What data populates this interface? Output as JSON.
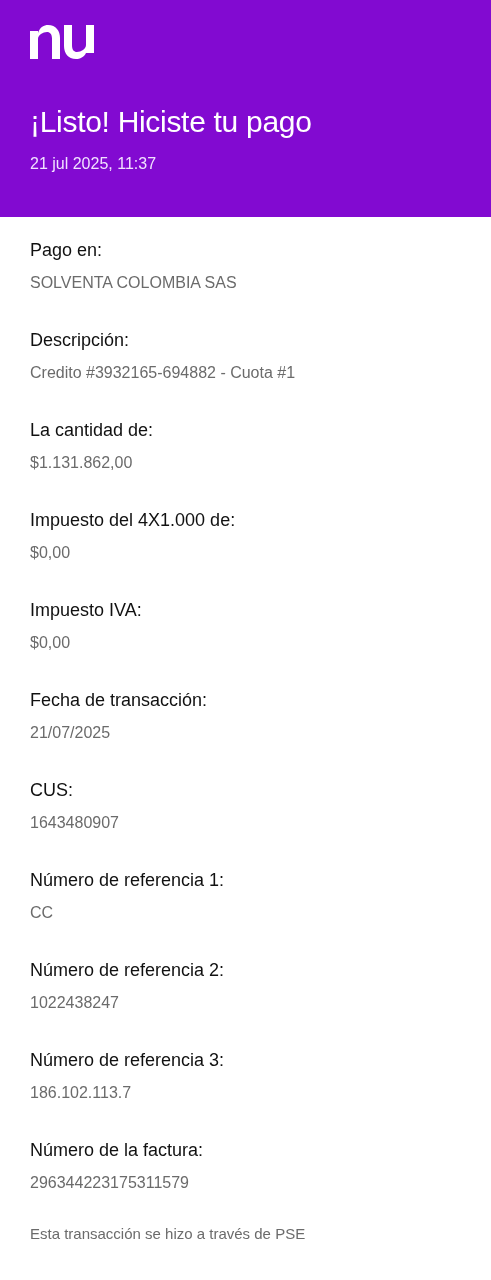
{
  "header": {
    "title": "¡Listo! Hiciste tu pago",
    "datetime": "21 jul 2025, 11:37"
  },
  "details": [
    {
      "label": "Pago en:",
      "value": "SOLVENTA COLOMBIA SAS"
    },
    {
      "label": "Descripción:",
      "value": "Credito #3932165-694882 - Cuota #1"
    },
    {
      "label": "La cantidad de:",
      "value": "$1.131.862,00"
    },
    {
      "label": "Impuesto del 4X1.000 de:",
      "value": "$0,00"
    },
    {
      "label": "Impuesto IVA:",
      "value": "$0,00"
    },
    {
      "label": "Fecha de transacción:",
      "value": "21/07/2025"
    },
    {
      "label": "CUS:",
      "value": "1643480907"
    },
    {
      "label": "Número de referencia 1:",
      "value": "CC"
    },
    {
      "label": "Número de referencia 2:",
      "value": "1022438247"
    },
    {
      "label": "Número de referencia 3:",
      "value": "186.102.113.7"
    },
    {
      "label": "Número de la factura:",
      "value": "296344223175311579"
    }
  ],
  "footer_note": "Esta transacción se hizo a través de PSE"
}
